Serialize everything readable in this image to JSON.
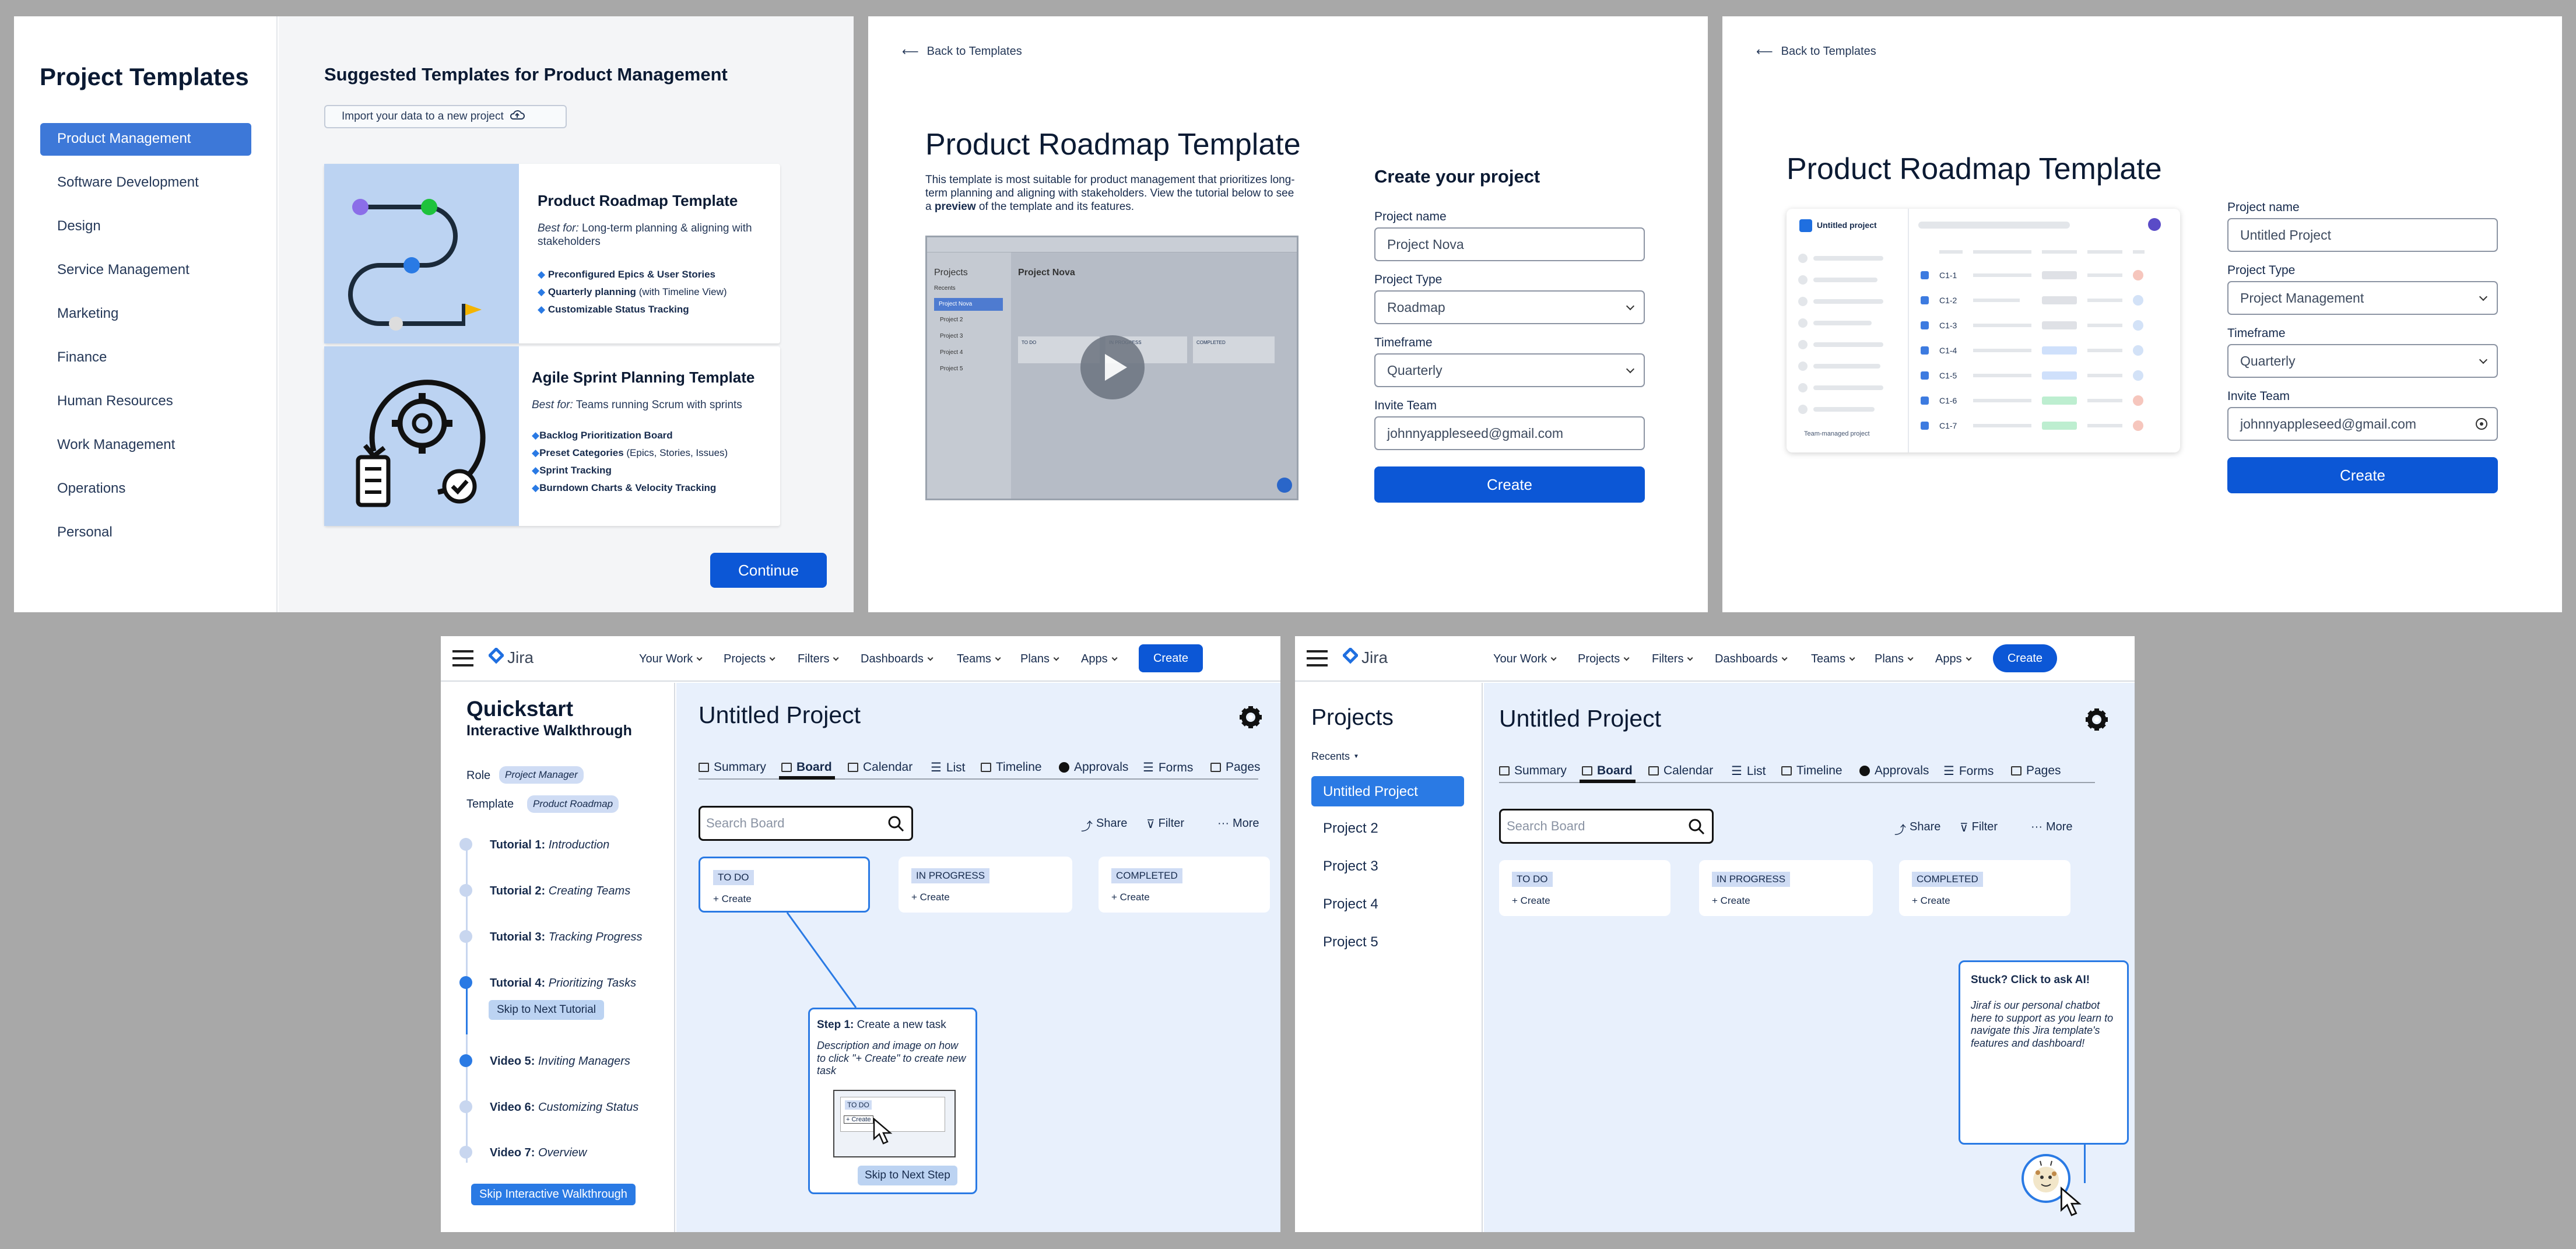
{
  "panel1": {
    "title": "Project Templates",
    "categories": [
      "Product Management",
      "Software Development",
      "Design",
      "Service Management",
      "Marketing",
      "Finance",
      "Human Resources",
      "Work Management",
      "Operations",
      "Personal"
    ],
    "suggested_title": "Suggested Templates for Product Management",
    "import_label": "Import your data to a new project",
    "template1": {
      "name": "Product Roadmap Template",
      "best_for_label": "Best for:",
      "best_for": "Long-term planning & aligning with stakeholders",
      "features": [
        {
          "b": "Preconfigured Epics & User Stories",
          "t": ""
        },
        {
          "b": "Quarterly planning",
          "t": "(with Timeline View)"
        },
        {
          "b": "Customizable Status Tracking",
          "t": ""
        }
      ]
    },
    "template2": {
      "name": "Agile Sprint Planning Template",
      "best_for_label": "Best for:",
      "best_for": "Teams running Scrum with sprints",
      "features": [
        {
          "b": "Backlog Prioritization Board",
          "t": ""
        },
        {
          "b": "Preset Categories",
          "t": "(Epics, Stories, Issues)"
        },
        {
          "b": "Sprint Tracking",
          "t": ""
        },
        {
          "b": "Burndown Charts & Velocity Tracking",
          "t": ""
        }
      ]
    },
    "continue_label": "Continue"
  },
  "panel2": {
    "back": "Back to Templates",
    "title": "Product Roadmap Template",
    "desc_pre": "This template is most suitable for product management that prioritizes long-term planning and aligning with stakeholders. View the tutorial below to see a",
    "desc_bold": "preview",
    "desc_post": "of the template and its features.",
    "create_heading": "Create your project",
    "name_label": "Project name",
    "name_placeholder": "Project Nova",
    "type_label": "Project Type",
    "type_value": "Roadmap",
    "timeframe_label": "Timeframe",
    "timeframe_value": "Quarterly",
    "invite_label": "Invite Team",
    "invite_value": "johnnyappleseed@gmail.com",
    "create_label": "Create",
    "video": {
      "projects": "Projects",
      "recents": "Recents",
      "items": [
        "Project Nova",
        "Project 2",
        "Project 3",
        "Project 4",
        "Project 5"
      ],
      "board_title": "Project Nova",
      "cols": [
        "TO DO",
        "IN PROGRESS",
        "COMPLETED"
      ]
    }
  },
  "panel3": {
    "back": "Back to Templates",
    "title": "Product Roadmap Template",
    "preview_project": "Untitled project",
    "preview_footer": "Team-managed project",
    "rows": [
      "C1-1",
      "C1-2",
      "C1-3",
      "C1-4",
      "C1-5",
      "C1-6",
      "C1-7"
    ],
    "name_label": "Project name",
    "name_placeholder": "Untitled Project",
    "type_label": "Project Type",
    "type_value": "Project Management",
    "timeframe_label": "Timeframe",
    "timeframe_value": "Quarterly",
    "invite_label": "Invite Team",
    "invite_value": "johnnyappleseed@gmail.com",
    "create_label": "Create"
  },
  "jira_nav": {
    "logo": "Jira",
    "menus": [
      "Your Work",
      "Projects",
      "Filters",
      "Dashboards",
      "Teams",
      "Plans",
      "Apps"
    ],
    "create": "Create"
  },
  "board": {
    "title": "Untitled Project",
    "tabs": [
      "Summary",
      "Board",
      "Calendar",
      "List",
      "Timeline",
      "Approvals",
      "Forms",
      "Pages"
    ],
    "search_placeholder": "Search Board",
    "share": "Share",
    "filter": "Filter",
    "more": "More",
    "cols": [
      "TO DO",
      "IN PROGRESS",
      "COMPLETED"
    ],
    "create": "+ Create"
  },
  "panel4": {
    "quickstart": "Quickstart",
    "walkthrough": "Interactive Walkthrough",
    "role_label": "Role",
    "role_value": "Project Manager",
    "template_label": "Template",
    "template_value": "Product Roadmap",
    "tutorials": [
      {
        "b": "Tutorial 1:",
        "i": "Introduction"
      },
      {
        "b": "Tutorial 2:",
        "i": "Creating Teams"
      },
      {
        "b": "Tutorial 3:",
        "i": "Tracking Progress"
      },
      {
        "b": "Tutorial 4:",
        "i": "Prioritizing Tasks"
      },
      {
        "b": "Video 5:",
        "i": "Inviting Managers"
      },
      {
        "b": "Video 6:",
        "i": "Customizing Status"
      },
      {
        "b": "Video 7:",
        "i": "Overview"
      }
    ],
    "skip_tutorial": "Skip to Next Tutorial",
    "skip_walkthrough": "Skip Interactive Walkthrough",
    "step_bold": "Step 1:",
    "step_text": "Create a new task",
    "step_desc": "Description and image on how to click \"+ Create\" to create new task",
    "mini_todo": "TO DO",
    "mini_create": "+ Create",
    "skip_step": "Skip to Next Step"
  },
  "panel5": {
    "projects": "Projects",
    "recents": "Recents",
    "items": [
      "Untitled Project",
      "Project 2",
      "Project 3",
      "Project 4",
      "Project 5"
    ],
    "chat_title": "Stuck? Click to ask AI!",
    "chat_body": "Jiraf is our personal chatbot here to support as you learn to navigate this Jira template's features and dashboard!"
  },
  "colors": {
    "primary": "#0c57d6",
    "board_bg": "#e8f0fc",
    "tag": "#cfdcf4",
    "highlight": "#2a7ae4"
  }
}
